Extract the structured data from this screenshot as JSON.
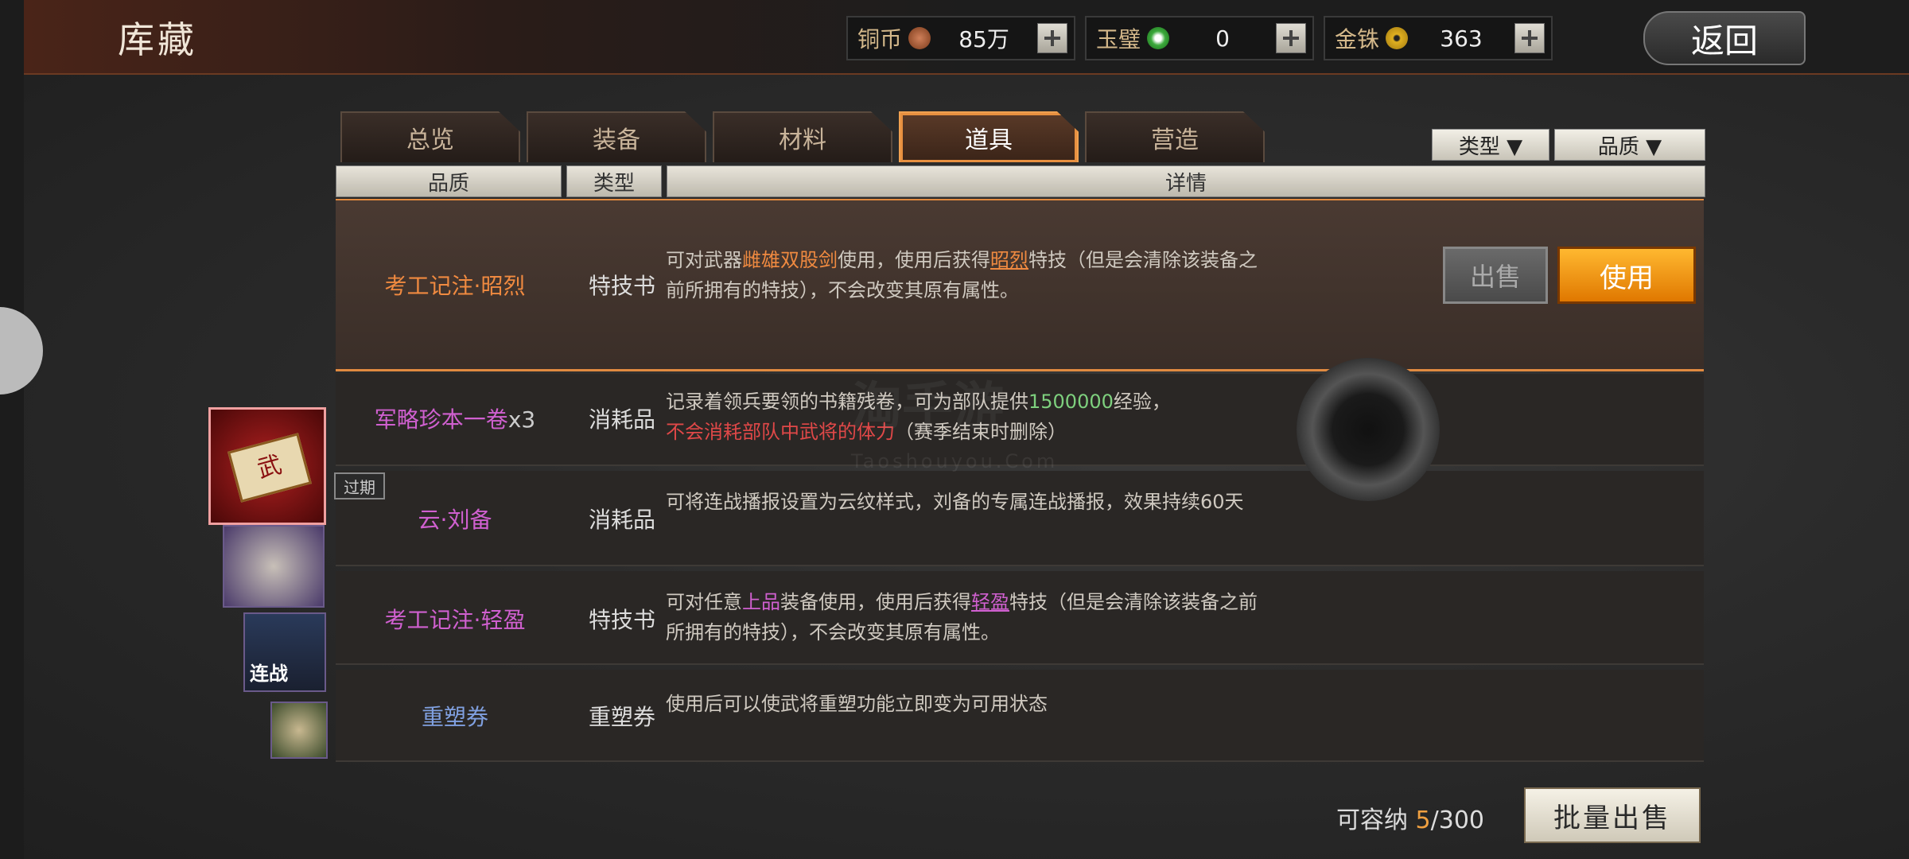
{
  "header": {
    "title": "库藏",
    "back_label": "返回"
  },
  "resources": [
    {
      "label": "铜币",
      "value": "85万",
      "color": "#a0522d"
    },
    {
      "label": "玉璧",
      "value": "0",
      "color": "#3caa3c"
    },
    {
      "label": "金铢",
      "value": "363",
      "color": "#d4a017"
    }
  ],
  "tabs": [
    {
      "label": "总览"
    },
    {
      "label": "装备"
    },
    {
      "label": "材料"
    },
    {
      "label": "道具"
    },
    {
      "label": "营造"
    }
  ],
  "active_tab": "道具",
  "filters": {
    "type_label": "类型 ▼",
    "quality_label": "品质 ▼"
  },
  "columns": {
    "quality": "品质",
    "type": "类型",
    "detail": "详情"
  },
  "items": [
    {
      "name": "考工记注·昭烈",
      "type": "特技书",
      "desc_a": "可对武器",
      "desc_b": "雌雄双股剑",
      "desc_c": "使用，使用后获得",
      "desc_d": "昭烈",
      "desc_e": "特技（但是会清除该装备之前所拥有的特技），不会改变其原有属性。"
    },
    {
      "name": "军略珍本一卷",
      "count": "x3",
      "type": "消耗品",
      "desc_a": "记录着领兵要领的书籍残卷，可为部队提供",
      "desc_b": "1500000",
      "desc_c": "经验，",
      "desc_d": "不会消耗部队中武将的体力",
      "desc_e": "（赛季结束时删除）"
    },
    {
      "name": "云·刘备",
      "type": "消耗品",
      "desc_a": "可将连战播报设置为云纹样式，刘备的专属连战播报，效果持续60天"
    },
    {
      "name": "考工记注·轻盈",
      "type": "特技书",
      "desc_a": "可对任意",
      "desc_b": "上品",
      "desc_c": "装备使用，使用后获得",
      "desc_d": "轻盈",
      "desc_e": "特技（但是会清除该装备之前所拥有的特技），不会改变其原有属性。"
    },
    {
      "name": "重塑券",
      "type": "重塑券",
      "desc_a": "使用后可以使武将重塑功能立即变为可用状态"
    }
  ],
  "actions": {
    "sell": "出售",
    "use": "使用",
    "bulk_sell": "批量出售"
  },
  "capacity": {
    "label": "可容纳",
    "used": "5",
    "total": "/300"
  },
  "expired_badge": "过期",
  "watermark": {
    "main": "淘手游",
    "sub": "Taoshouyou.Com"
  },
  "icon_text": {
    "lianzhan": "连战",
    "wu": "武"
  }
}
